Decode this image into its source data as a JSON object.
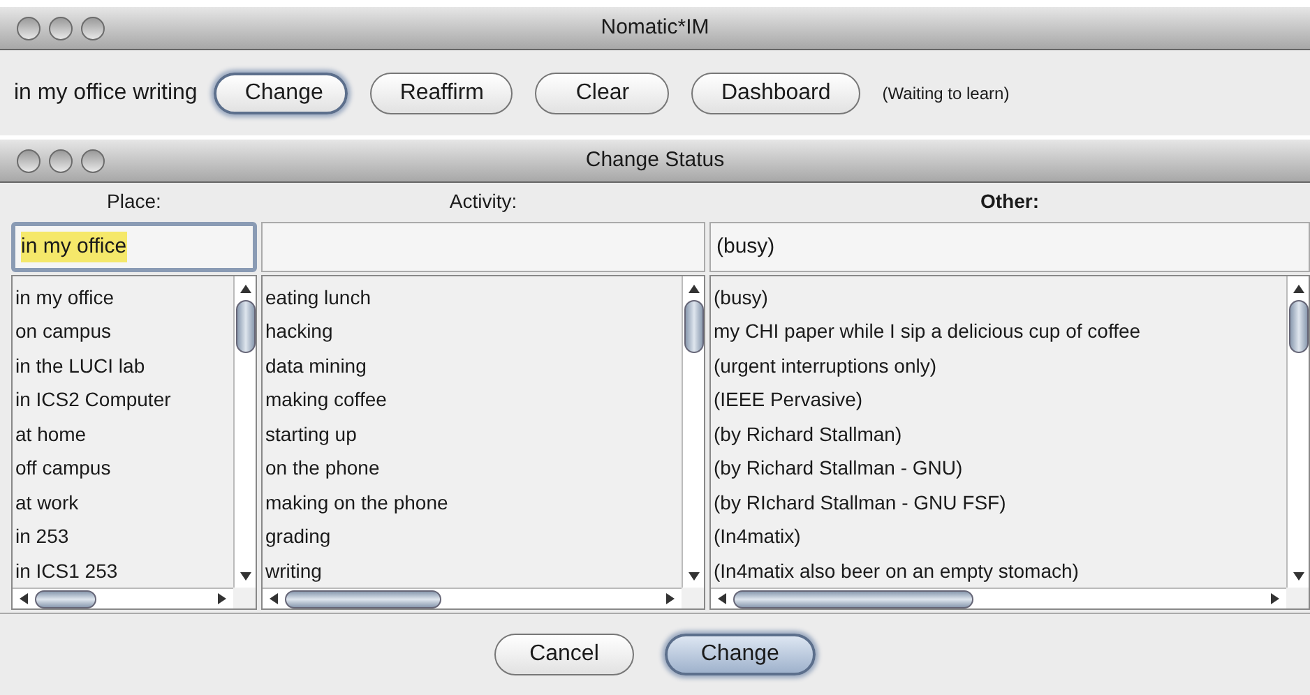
{
  "main_window": {
    "title": "Nomatic*IM",
    "status_text": "in my office writing",
    "buttons": [
      {
        "label": "Change",
        "default": true
      },
      {
        "label": "Reaffirm",
        "default": false
      },
      {
        "label": "Clear",
        "default": false
      },
      {
        "label": "Dashboard",
        "default": false
      }
    ],
    "note": "(Waiting to learn)"
  },
  "dialog": {
    "title": "Change Status",
    "columns": [
      {
        "header": "Place:",
        "bold": false,
        "field": {
          "value": "in my office",
          "focused": true
        },
        "items": [
          "in my office",
          "on campus",
          "in the LUCI lab",
          "in ICS2 Computer",
          "at home",
          "off campus",
          "at work",
          "in  253",
          "in ICS1 253"
        ]
      },
      {
        "header": "Activity:",
        "bold": false,
        "field": {
          "focused": false
        },
        "items": [
          "eating lunch",
          "hacking",
          "data mining",
          "making coffee",
          "starting up",
          "on the phone",
          "making on the phone",
          "grading",
          "writing"
        ]
      },
      {
        "header": "Other:",
        "bold": true,
        "field": {
          "value": "(busy)",
          "focused": false
        },
        "items": [
          "(busy)",
          "my CHI paper while I sip a delicious cup of coffee",
          "(urgent interruptions only)",
          "(IEEE Pervasive)",
          "(by Richard Stallman)",
          "(by Richard Stallman - GNU)",
          "(by RIchard Stallman - GNU FSF)",
          "(In4matix)",
          "(In4matix also beer on an empty stomach)"
        ]
      }
    ],
    "buttons": [
      {
        "label": "Cancel",
        "default": false
      },
      {
        "label": "Change",
        "default": true
      }
    ]
  }
}
